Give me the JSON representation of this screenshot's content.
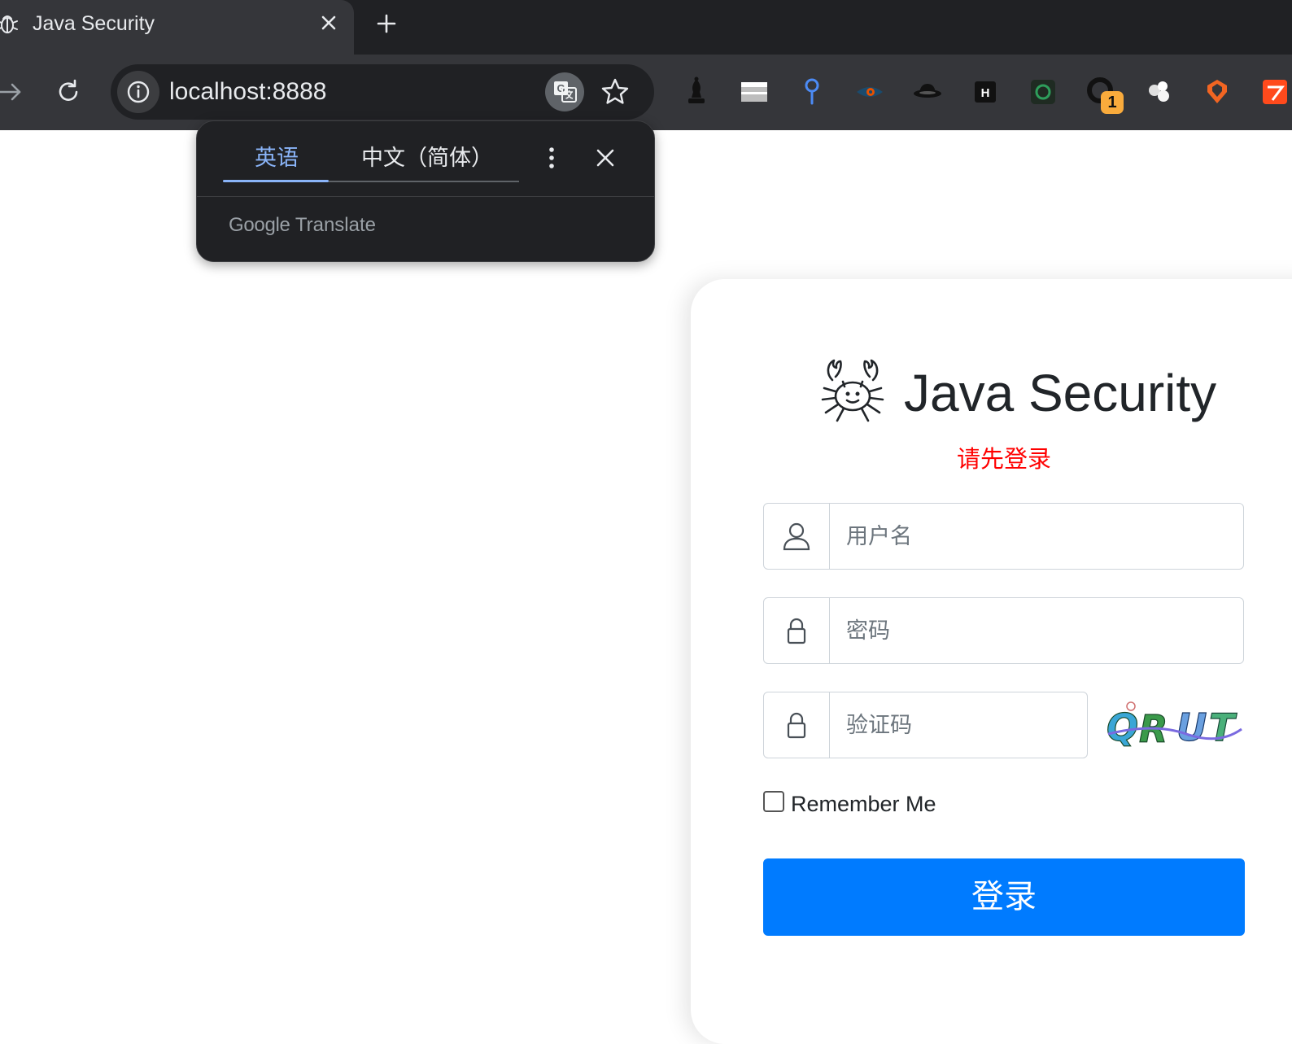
{
  "browser": {
    "tab_title": "Java Security",
    "url": "localhost:8888",
    "extension_badge": "1",
    "icons": [
      "bug-icon",
      "close-icon",
      "plus-icon",
      "forward-arrow-icon",
      "reload-icon",
      "info-icon",
      "translate-icon",
      "star-icon"
    ]
  },
  "translate_popup": {
    "source_lang": "英语",
    "target_lang": "中文（简体）",
    "brand_google": "Google",
    "brand_translate": "Translate"
  },
  "login": {
    "title": "Java Security",
    "notice": "请先登录",
    "username_placeholder": "用户名",
    "password_placeholder": "密码",
    "captcha_placeholder": "验证码",
    "captcha_text": "QRUT",
    "remember_label": "Remember Me",
    "submit_label": "登录"
  },
  "colors": {
    "primary": "#007bff",
    "notice": "#ff0000",
    "chrome_dark": "#202124",
    "chrome_toolbar": "#35363a",
    "translate_accent": "#8ab4f8"
  }
}
